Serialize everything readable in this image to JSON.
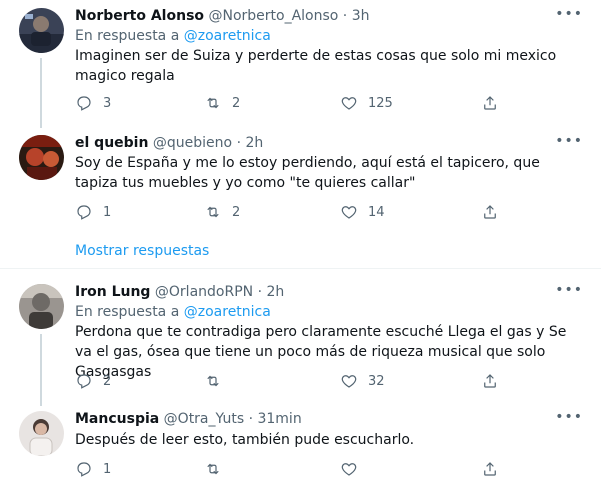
{
  "reply_prefix": "En respuesta a",
  "show_replies_label": "Mostrar respuestas",
  "tweets": [
    {
      "name": "Norberto Alonso",
      "handle": "@Norberto_Alonso",
      "separator": "·",
      "time": "3h",
      "reply_to": "@zoaretnica",
      "text": "Imaginen ser de Suiza y perderte de estas cosas que solo mi mexico magico regala",
      "replies": "3",
      "retweets": "2",
      "likes": "125",
      "more": "•••"
    },
    {
      "name": "el quebin",
      "handle": "@quebieno",
      "separator": "·",
      "time": "2h",
      "text": "Soy de España y me lo estoy perdiendo, aquí está el tapicero, que tapiza tus muebles y yo como \"te quieres callar\"",
      "replies": "1",
      "retweets": "2",
      "likes": "14",
      "more": "•••"
    },
    {
      "name": "Iron Lung",
      "handle": "@OrlandoRPN",
      "separator": "·",
      "time": "2h",
      "reply_to": "@zoaretnica",
      "text": "Perdona que te contradiga pero claramente escuché Llega el gas y Se va el gas, ósea que tiene un poco más de riqueza musical que solo Gasgasgas",
      "replies": "2",
      "retweets": "",
      "likes": "32",
      "more": "•••"
    },
    {
      "name": "Mancuspia",
      "handle": "@Otra_Yuts",
      "separator": "·",
      "time": "31min",
      "text": "Después de leer esto, también pude escucharlo.",
      "replies": "1",
      "retweets": "",
      "likes": "",
      "more": "•••"
    }
  ],
  "colors": {
    "accent": "#1d9bf0",
    "secondary_text": "#536471",
    "primary_text": "#0f1419",
    "divider": "#eff3f4"
  },
  "icons": [
    "reply-icon",
    "retweet-icon",
    "like-icon",
    "share-icon",
    "more-options-icon"
  ]
}
